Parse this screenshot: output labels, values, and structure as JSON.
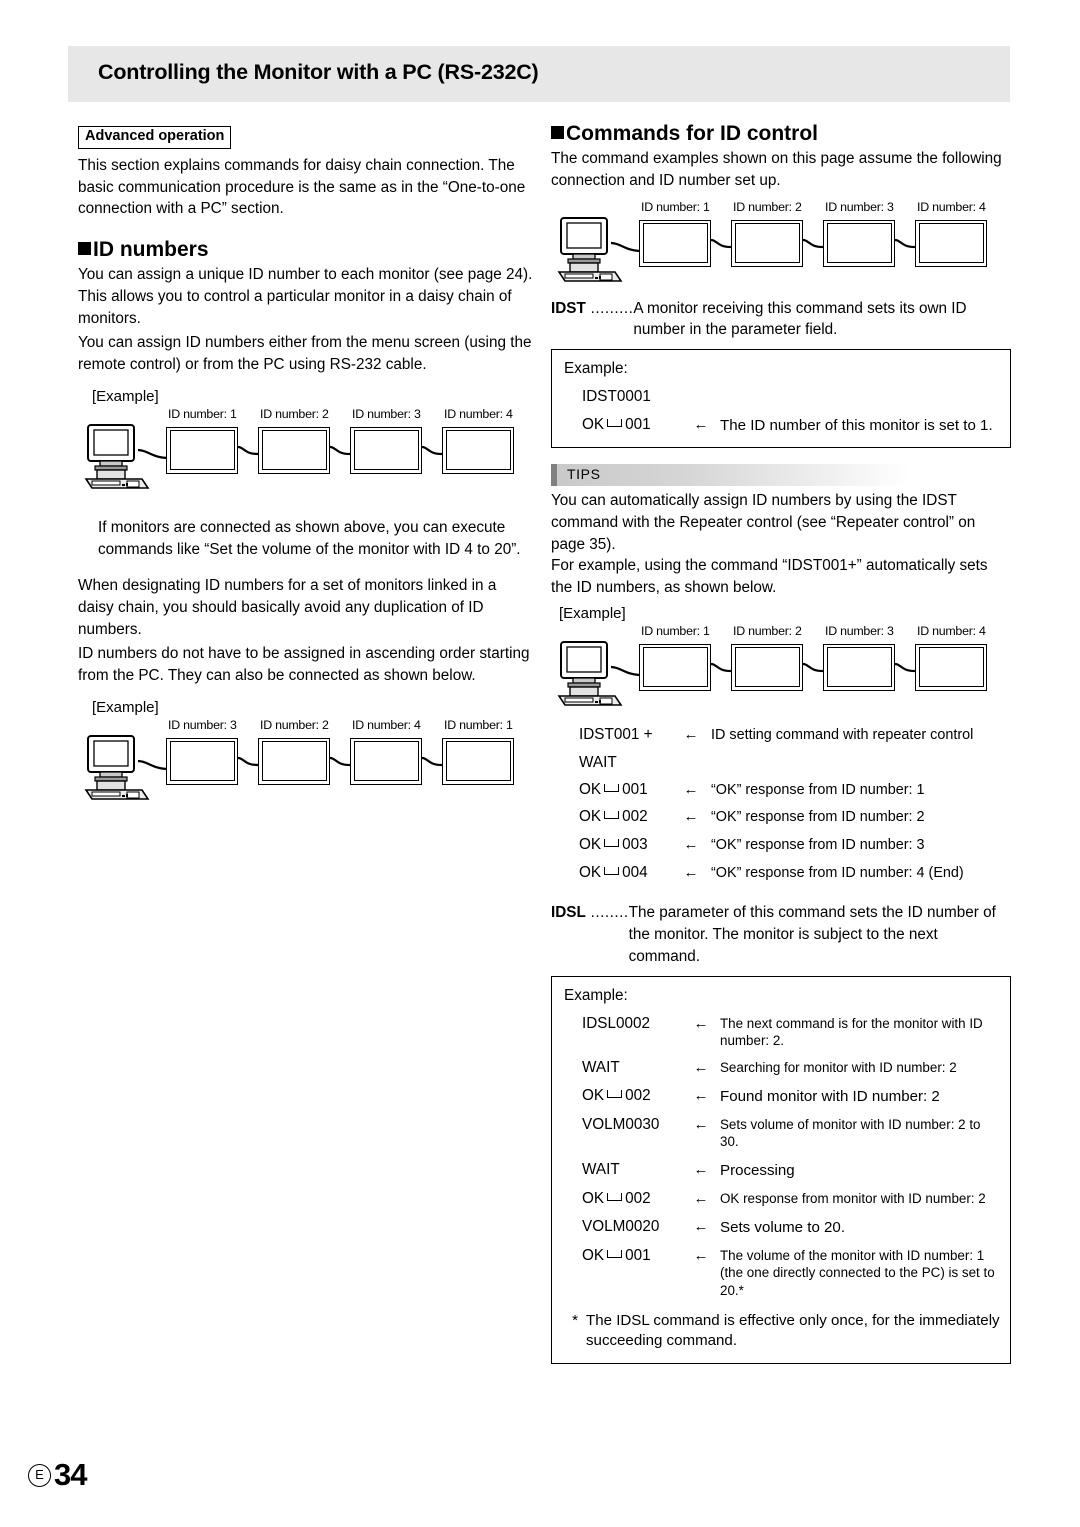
{
  "header": {
    "title": "Controlling the Monitor with a PC (RS-232C)"
  },
  "left": {
    "advanced_tag": "Advanced operation",
    "intro": "This section explains commands for daisy chain connection. The basic communication procedure is the same as in the “One-to-one connection with a PC” section.",
    "id_numbers_heading": "ID numbers",
    "p1": "You can assign a unique ID number to each monitor (see page 24). This allows you to control a particular monitor in a daisy chain of monitors.",
    "p2": "You can assign ID numbers either from the menu screen (using the remote control) or from the PC using RS-232 cable.",
    "example_label_1": "[Example]",
    "diagram1_labels": [
      "ID number: 1",
      "ID number: 2",
      "ID number: 3",
      "ID number: 4"
    ],
    "note1": "If monitors are connected as shown above, you can execute commands like “Set the volume of the monitor with ID 4 to 20”.",
    "p3": "When designating ID numbers for a set of monitors linked in a daisy chain, you should basically avoid any duplication of ID numbers.",
    "p4": "ID numbers do not have to be assigned in ascending order starting from the PC. They can also be connected as shown below.",
    "example_label_2": "[Example]",
    "diagram2_labels": [
      "ID number: 3",
      "ID number: 2",
      "ID number: 4",
      "ID number: 1"
    ]
  },
  "right": {
    "commands_heading": "Commands for ID control",
    "intro": "The command examples shown on this page assume the following connection and ID number set up.",
    "diagram1_labels": [
      "ID number: 1",
      "ID number: 2",
      "ID number: 3",
      "ID number: 4"
    ],
    "idst": {
      "name": "IDST",
      "dots": " .........",
      "desc": "A monitor receiving this command sets its own ID number in the parameter field.",
      "example_title": "Example:",
      "rows": [
        {
          "code": "IDST0001",
          "arrow": "",
          "note": ""
        },
        {
          "code_pre": "OK",
          "code_post": "001",
          "arrow": "←",
          "note": "The ID number of this monitor is set to 1."
        }
      ]
    },
    "tips": {
      "label": "TIPS",
      "p1": "You can automatically assign ID numbers by using the IDST command with the Repeater control (see “Repeater control” on page 35).",
      "p2": "For example, using the command “IDST001+” automatically sets the ID numbers, as shown below.",
      "example_label": "[Example]",
      "diagram_labels": [
        "ID number: 1",
        "ID number: 2",
        "ID number: 3",
        "ID number: 4"
      ],
      "rows": [
        {
          "code": "IDST001 +",
          "arrow": "←",
          "note": "ID setting command with repeater control"
        },
        {
          "code": "WAIT",
          "arrow": "",
          "note": ""
        },
        {
          "code_pre": "OK",
          "code_post": "001",
          "arrow": "←",
          "note": "“OK” response from ID number: 1"
        },
        {
          "code_pre": "OK",
          "code_post": "002",
          "arrow": "←",
          "note": "“OK” response from ID number: 2"
        },
        {
          "code_pre": "OK",
          "code_post": "003",
          "arrow": "←",
          "note": "“OK” response from ID number: 3"
        },
        {
          "code_pre": "OK",
          "code_post": "004",
          "arrow": "←",
          "note": "“OK” response from ID number: 4 (End)"
        }
      ]
    },
    "idsl": {
      "name": "IDSL",
      "dots": " ........",
      "desc": "The parameter of this command sets the ID number of the monitor. The monitor is subject to the next command.",
      "example_title": "Example:",
      "rows": [
        {
          "code": "IDSL0002",
          "arrow": "←",
          "note": "The next command is for the monitor with ID number: 2."
        },
        {
          "code": "WAIT",
          "arrow": "←",
          "note": "Searching for monitor with ID number: 2"
        },
        {
          "code_pre": "OK",
          "code_post": "002",
          "arrow": "←",
          "note": "Found monitor with ID number: 2",
          "big": true
        },
        {
          "code": "VOLM0030",
          "arrow": "←",
          "note": "Sets volume of monitor with ID number: 2 to 30."
        },
        {
          "code": "WAIT",
          "arrow": "←",
          "note": "Processing",
          "big": true
        },
        {
          "code_pre": "OK",
          "code_post": "002",
          "arrow": "←",
          "note": "OK response from monitor with ID number: 2"
        },
        {
          "code": "VOLM0020",
          "arrow": "←",
          "note": "Sets volume to 20.",
          "big": true
        },
        {
          "code_pre": "OK",
          "code_post": "001",
          "arrow": "←",
          "note": "The volume of the monitor with ID number: 1 (the one directly connected to the PC) is set to 20.*"
        }
      ],
      "footnote_star": "*",
      "footnote": "The IDSL command is effective only once, for the immediately succeeding command."
    }
  },
  "footer": {
    "edition": "E",
    "page": "34"
  }
}
